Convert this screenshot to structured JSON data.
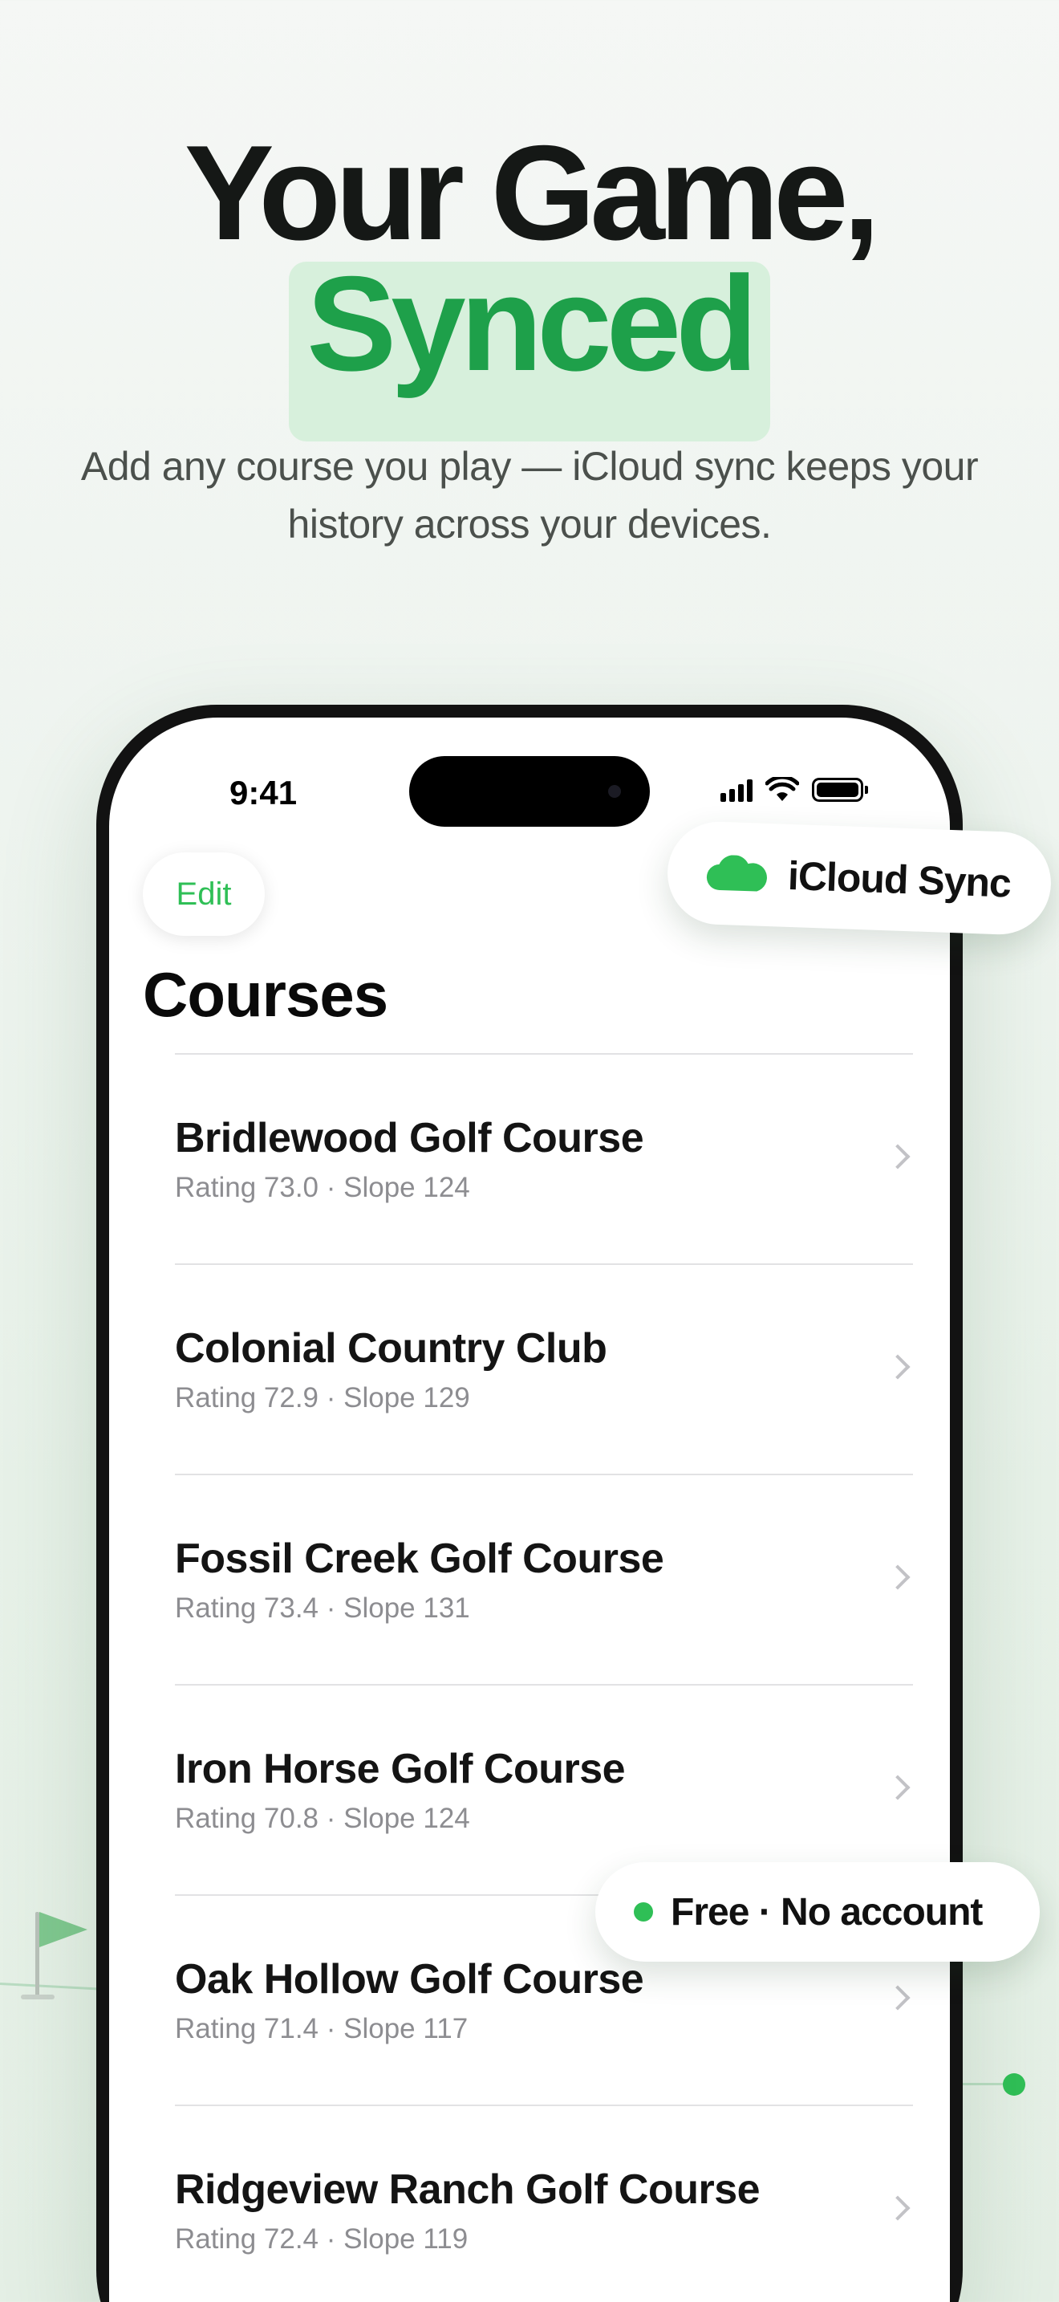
{
  "hero": {
    "title_line1": "Your Game,",
    "title_line2": "Synced",
    "subtitle": "Add any course you play — iCloud sync keeps your history across your devices."
  },
  "phone": {
    "status_time": "9:41",
    "edit_label": "Edit",
    "screen_title": "Courses",
    "courses": [
      {
        "name": "Bridlewood Golf Course",
        "meta": "Rating 73.0 · Slope 124"
      },
      {
        "name": "Colonial Country Club",
        "meta": "Rating 72.9 · Slope 129"
      },
      {
        "name": "Fossil Creek Golf Course",
        "meta": "Rating 73.4 · Slope 131"
      },
      {
        "name": "Iron Horse Golf Course",
        "meta": "Rating 70.8 · Slope 124"
      },
      {
        "name": "Oak Hollow Golf Course",
        "meta": "Rating 71.4 · Slope 117"
      },
      {
        "name": "Ridgeview Ranch Golf Course",
        "meta": "Rating 72.4 · Slope 119"
      }
    ]
  },
  "badges": {
    "icloud_label": "iCloud Sync",
    "icloud_icon": "cloud-icon",
    "free_label": "Free · No account"
  },
  "colors": {
    "accent_green": "#2fbf56",
    "headline_green": "#1ea04a",
    "highlight_bg": "#d7f0dc"
  }
}
